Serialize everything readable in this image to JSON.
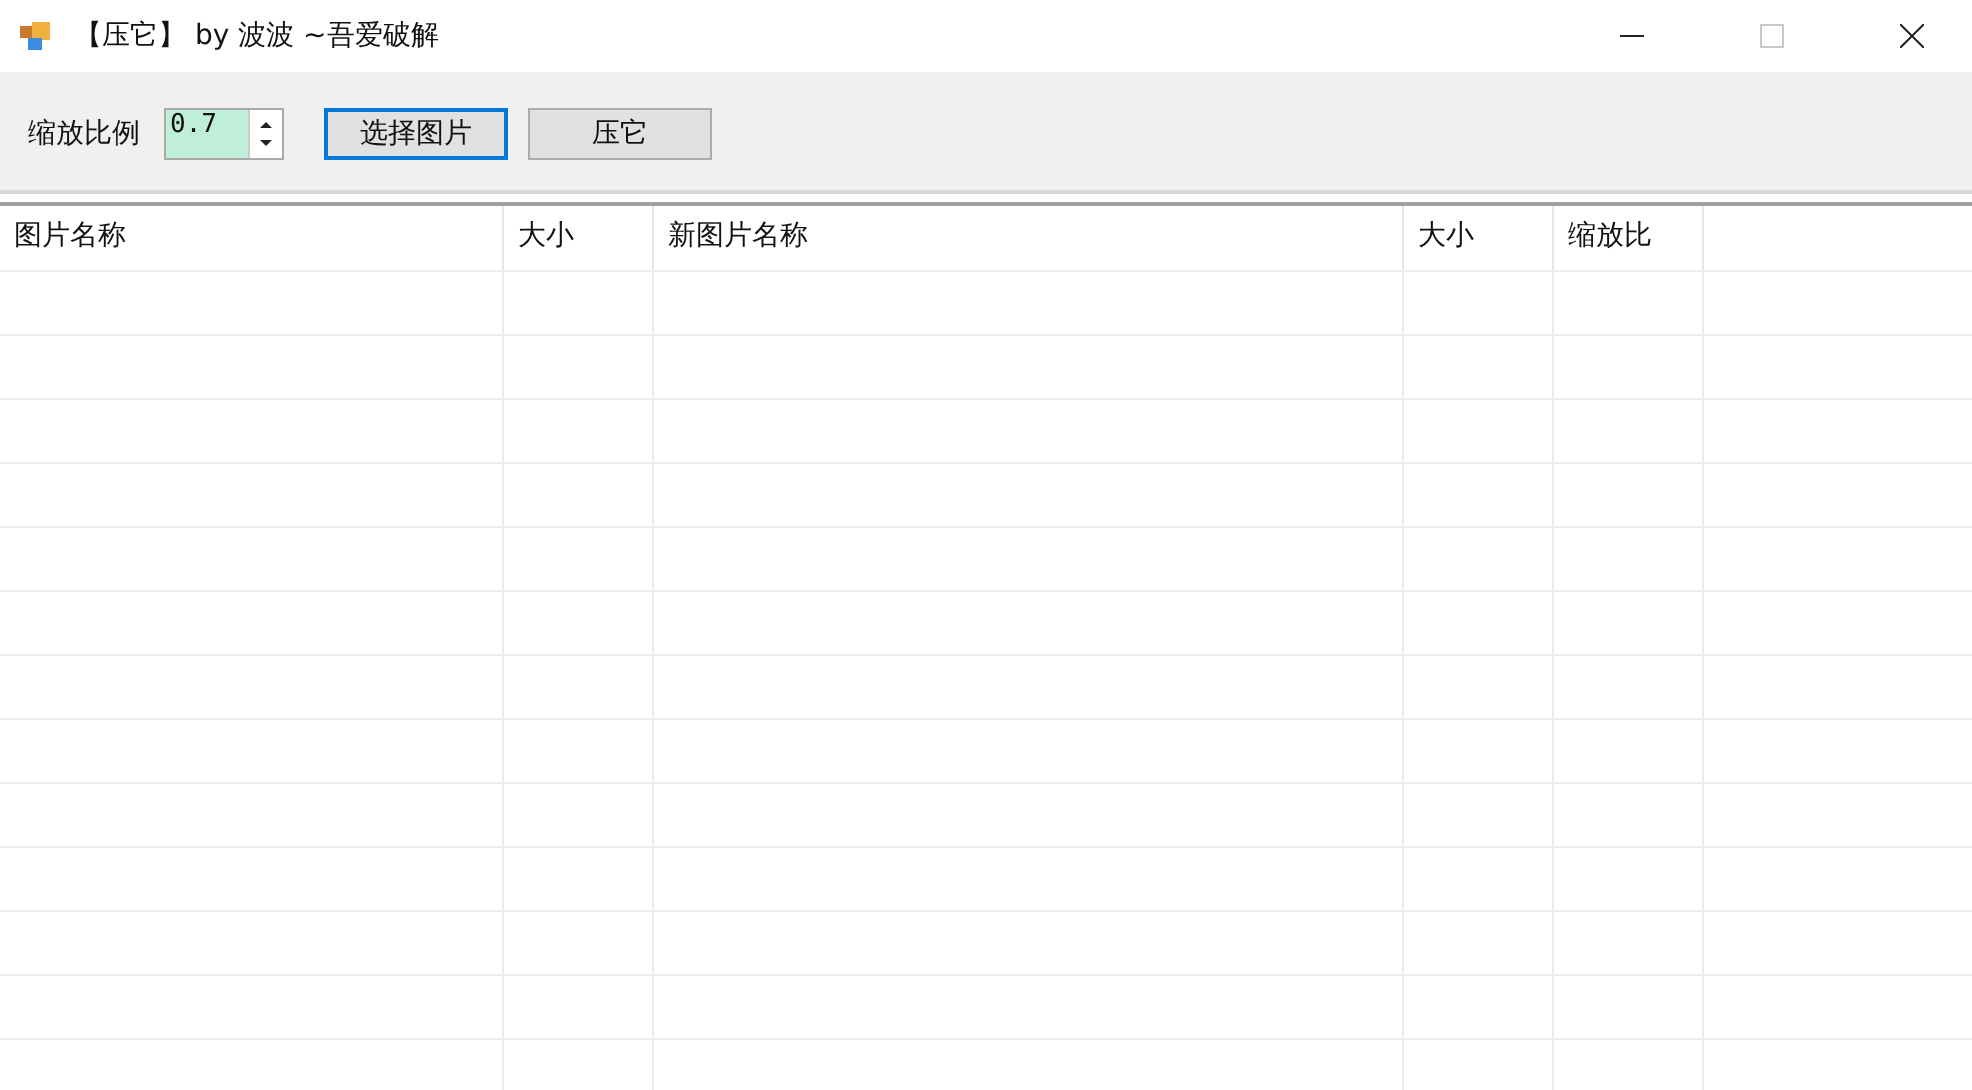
{
  "window": {
    "title": "【压它】 by 波波 ~吾爱破解",
    "maximize_disabled": true
  },
  "toolbar": {
    "scale_label": "缩放比例",
    "scale_value": "0.7",
    "buttons": [
      {
        "label": "选择图片",
        "focused": true
      },
      {
        "label": "压它",
        "focused": false
      }
    ]
  },
  "table": {
    "columns": [
      "图片名称",
      "大小",
      "新图片名称",
      "大小",
      "缩放比"
    ]
  }
}
